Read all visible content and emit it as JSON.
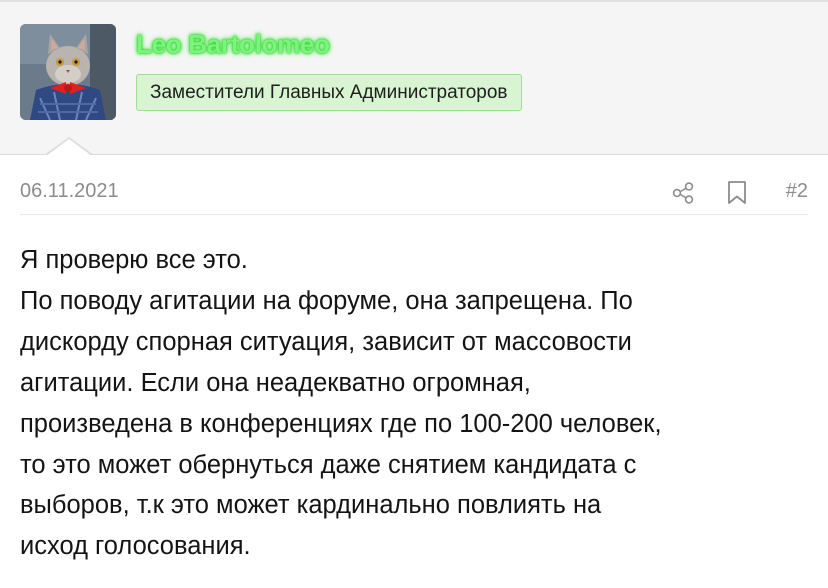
{
  "user": {
    "name": "Leo Bartolomeo",
    "role": "Заместители Главных Администраторов",
    "avatar": "cat-in-bowtie-avatar"
  },
  "post": {
    "date": "06.11.2021",
    "number": "#2",
    "icons": {
      "share": "share-icon",
      "bookmark": "bookmark-icon"
    },
    "lines": [
      "Я проверю все это.",
      "По поводу агитации на форуме, она запрещена. По",
      "дискорду спорная ситуация, зависит от массовости",
      "агитации. Если она неадекватно огромная,",
      "произведена в конференциях где по 100-200 человек,",
      "то это может обернуться даже снятием кандидата с",
      "выборов, т.к это может кардинально повлиять на",
      "исход голосования."
    ]
  },
  "colors": {
    "username": "#7cf57c",
    "role_badge_bg": "#d8f5d2",
    "role_badge_border": "#9fdc95",
    "meta_text": "#8c8c8c",
    "body_text": "#141414"
  }
}
